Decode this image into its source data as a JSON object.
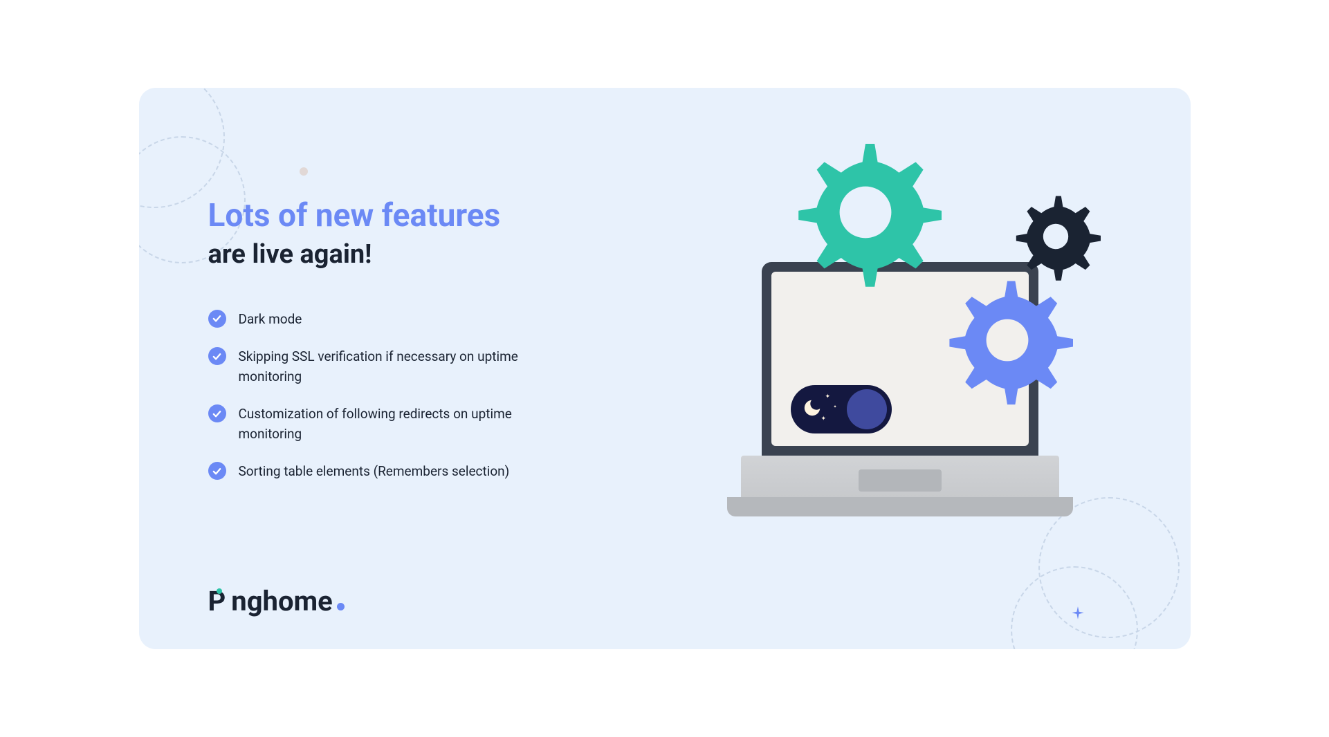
{
  "heading": {
    "line1": "Lots of new features",
    "line2": "are live again!"
  },
  "features": [
    {
      "text": "Dark mode"
    },
    {
      "text": "Skipping SSL verification if necessary on uptime monitoring"
    },
    {
      "text": "Customization of following redirects on uptime monitoring"
    },
    {
      "text": "Sorting table elements (Remembers selection)"
    }
  ],
  "brand": {
    "name_part1": "P",
    "name_part2": "nghome"
  },
  "colors": {
    "accent_blue": "#6b89f5",
    "accent_teal": "#2ec4a8",
    "dark": "#1a2332",
    "bg": "#e8f1fc"
  }
}
